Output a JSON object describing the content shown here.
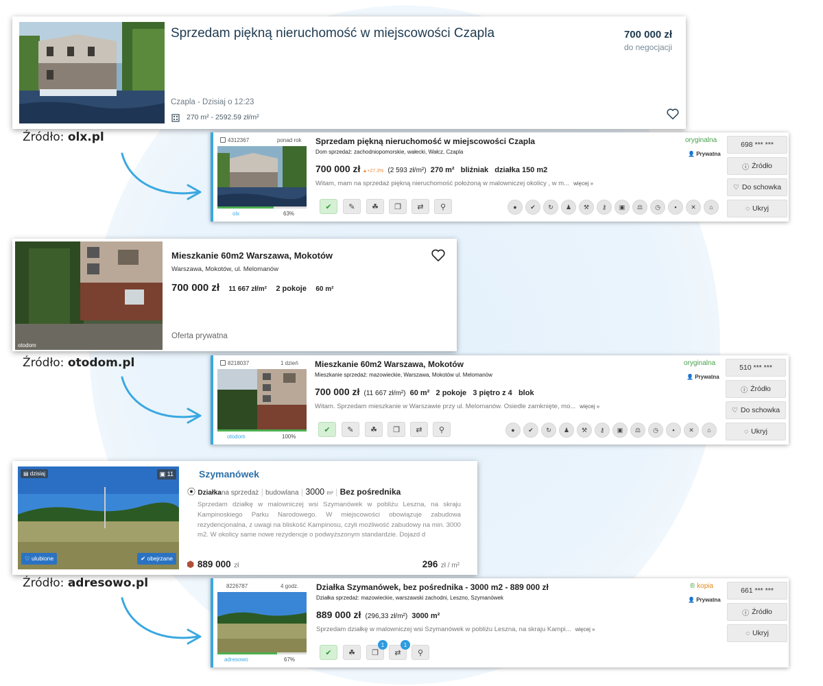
{
  "colors": {
    "accent": "#3aa8e0",
    "green": "#46a049",
    "orange": "#f08a3c",
    "adresowo_title": "#2c6fa8"
  },
  "olx_card": {
    "title": "Sprzedam piękną nieruchomość w miejscowości Czapla",
    "price": "700 000 zł",
    "price_note": "do negocjacji",
    "location_date": "Czapla - Dzisiaj o 12:23",
    "area": "270 m² - 2592.59 zł/m²",
    "icons": {
      "area": "building-icon",
      "fav": "heart-icon"
    }
  },
  "source_olx": {
    "prefix": "Źródło: ",
    "name": "olx.pl"
  },
  "agg_olx": {
    "id": "4312367",
    "age": "ponad rok",
    "title": "Sprzedam piękną nieruchomość w miejscowości Czapla",
    "subtitle": "Dom sprzedaż: zachodniopomorskie, wałecki, Wałcz, Czapla",
    "price": "700 000 zł",
    "change": "▲+27.3%",
    "per_m2": "(2 593 zł/m²)",
    "area": "270 m²",
    "type": "bliźniak",
    "plot": "działka 150 m2",
    "desc": "Witam, mam na sprzedaż piękną nieruchomość położoną w malowniczej okolicy , w m...",
    "more": "więcej »",
    "status": "oryginalna",
    "private": "Prywatna",
    "source": "olx",
    "percent": "63%",
    "percent_value": 63,
    "phone": "698 *** ***",
    "btn_source": "Źródło",
    "btn_save": "Do schowka",
    "btn_hide": "Ukryj"
  },
  "otodom_card": {
    "title": "Mieszkanie 60m2 Warszawa, Mokotów",
    "address": "Warszawa, Mokotów, ul. Melomanów",
    "price": "700 000 zł",
    "per_m2": "11 667 zł/m²",
    "rooms": "2 pokoje",
    "area": "60 m²",
    "offer": "Oferta prywatna",
    "watermark": "otodom"
  },
  "source_otodom": {
    "prefix": "Źródło: ",
    "name": "otodom.pl"
  },
  "agg_otodom": {
    "id": "8218037",
    "age": "1 dzień",
    "title": "Mieszkanie 60m2 Warszawa, Mokotów",
    "subtitle": "Mieszkanie sprzedaż: mazowieckie, Warszawa, Mokotów ul. Melomanów",
    "price": "700 000 zł",
    "per_m2": "(11 667 zł/m²)",
    "area": "60 m²",
    "rooms": "2 pokoje",
    "floor": "3 piętro z 4",
    "type": "blok",
    "desc": "Witam. Sprzedam mieszkanie w Warszawie przy ul. Melomanów. Osiedle zamknięte, mo...",
    "more": "więcej »",
    "status": "oryginalna",
    "private": "Prywatna",
    "source": "otodom",
    "percent": "100%",
    "percent_value": 100,
    "phone": "510 *** ***",
    "btn_source": "Źródło",
    "btn_save": "Do schowka",
    "btn_hide": "Ukryj"
  },
  "adresowo_card": {
    "title": "Szymanówek",
    "day": "dzisiaj",
    "photos": "11",
    "kind": "Działka",
    "kind_rest": "na sprzedaż",
    "sub": "budowlana",
    "area": "3000",
    "area_unit": "m²",
    "direct": "Bez pośrednika",
    "desc": "Sprzedam działkę w malowniczej wsi Szymanówek w pobliżu Leszna, na skraju Kampinoskiego Parku Narodowego. W miejscowości obowiązuje zabudowa rezydencjonalna, z uwagi na bliskość Kampinosu, czyli możliwość zabudowy na min. 3000 m2. W okolicy same nowe rezydencje o podwyższonym standardzie. Dojazd d",
    "fav": "ulubione",
    "seen": "obejrzane",
    "price": "889 000",
    "price_unit": "zł",
    "per_m2": "296",
    "per_m2_unit": "zł / m²"
  },
  "source_adresowo": {
    "prefix": "Źródło: ",
    "name": "adresowo.pl"
  },
  "agg_adresowo": {
    "id": "8226787",
    "age": "4 godz.",
    "title": "Działka Szymanówek, bez pośrednika - 3000 m2 - 889 000 zł",
    "subtitle": "Działka sprzedaż: mazowieckie, warszawski zachodni, Leszno, Szymanówek",
    "price": "889 000 zł",
    "per_m2": "(296,33 zł/m²)",
    "area": "3000 m²",
    "desc": "Sprzedam działkę w malowniczej wsi Szymanówek w pobliżu Leszna, na skraju Kampi...",
    "more": "więcej »",
    "status": "kopia",
    "private": "Prywatna",
    "source": "adresowo",
    "percent": "67%",
    "percent_value": 67,
    "phone": "661 *** ***",
    "btn_source": "Źródło",
    "btn_hide": "Ukryj",
    "badge1": "1",
    "badge2": "1"
  }
}
